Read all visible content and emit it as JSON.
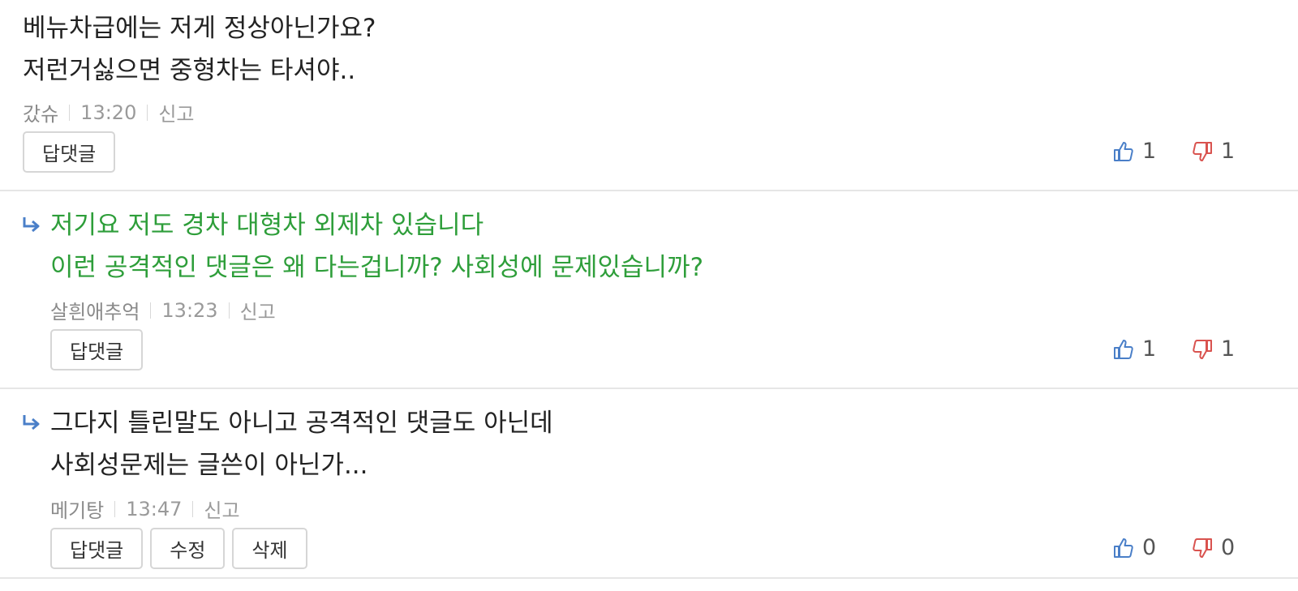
{
  "comments": [
    {
      "lines": [
        "베뉴차급에는 저게 정상아닌가요?",
        "저런거싫으면 중형차는 타셔야.."
      ],
      "author": "갔슈",
      "time": "13:20",
      "report": "신고",
      "buttons": [
        "답댓글"
      ],
      "likes": "1",
      "dislikes": "1",
      "is_reply": false
    },
    {
      "lines": [
        "저기요 저도 경차 대형차 외제차 있습니다",
        "이런 공격적인 댓글은 왜 다는겁니까? 사회성에 문제있습니까?"
      ],
      "author": "살흰애추억",
      "time": "13:23",
      "report": "신고",
      "buttons": [
        "답댓글"
      ],
      "likes": "1",
      "dislikes": "1",
      "is_reply": true
    },
    {
      "lines": [
        "그다지 틀린말도 아니고 공격적인 댓글도 아닌데",
        "사회성문제는 글쓴이 아닌가..."
      ],
      "author": "메기탕",
      "time": "13:47",
      "report": "신고",
      "buttons": [
        "답댓글",
        "수정",
        "삭제"
      ],
      "likes": "0",
      "dislikes": "0",
      "is_reply": true
    }
  ],
  "colors": {
    "reply_text_green": "#2e9e3a",
    "like_icon_blue": "#4a7fc8",
    "dislike_icon_red": "#d9534f",
    "reply_arrow_blue": "#4a7fc8"
  },
  "icons": {
    "like": "thumbs-up-icon",
    "dislike": "thumbs-down-icon",
    "reply": "reply-arrow-icon"
  }
}
